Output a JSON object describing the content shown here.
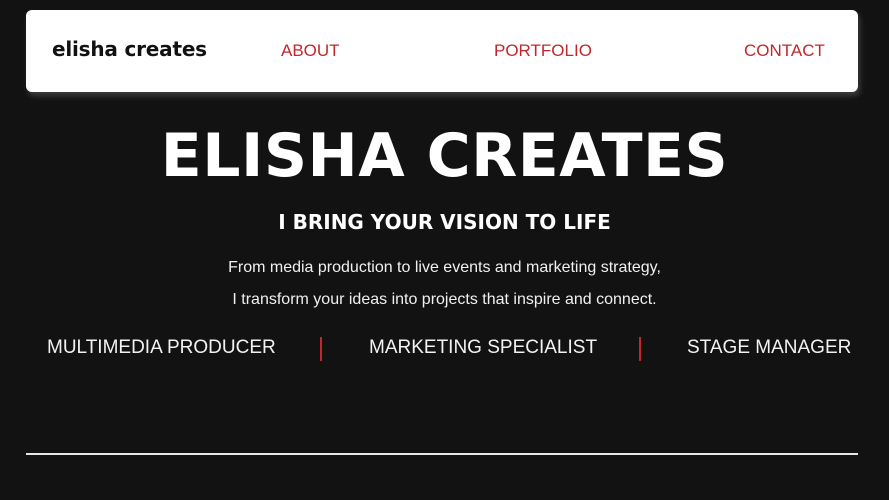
{
  "nav": {
    "logo": "elisha creates",
    "links": [
      "ABOUT",
      "PORTFOLIO",
      "CONTACT"
    ]
  },
  "hero": {
    "title": "ELISHA CREATES",
    "subtitle": "I BRING YOUR VISION TO LIFE",
    "description_line1": "From media production to live events and marketing strategy,",
    "description_line2": "I transform your ideas into projects that inspire and connect."
  },
  "roles": [
    "MULTIMEDIA PRODUCER",
    "MARKETING SPECIALIST",
    "STAGE MANAGER"
  ],
  "colors": {
    "background": "#121212",
    "accent": "#c0282d",
    "navbar": "#ffffff",
    "text": "#ffffff"
  }
}
